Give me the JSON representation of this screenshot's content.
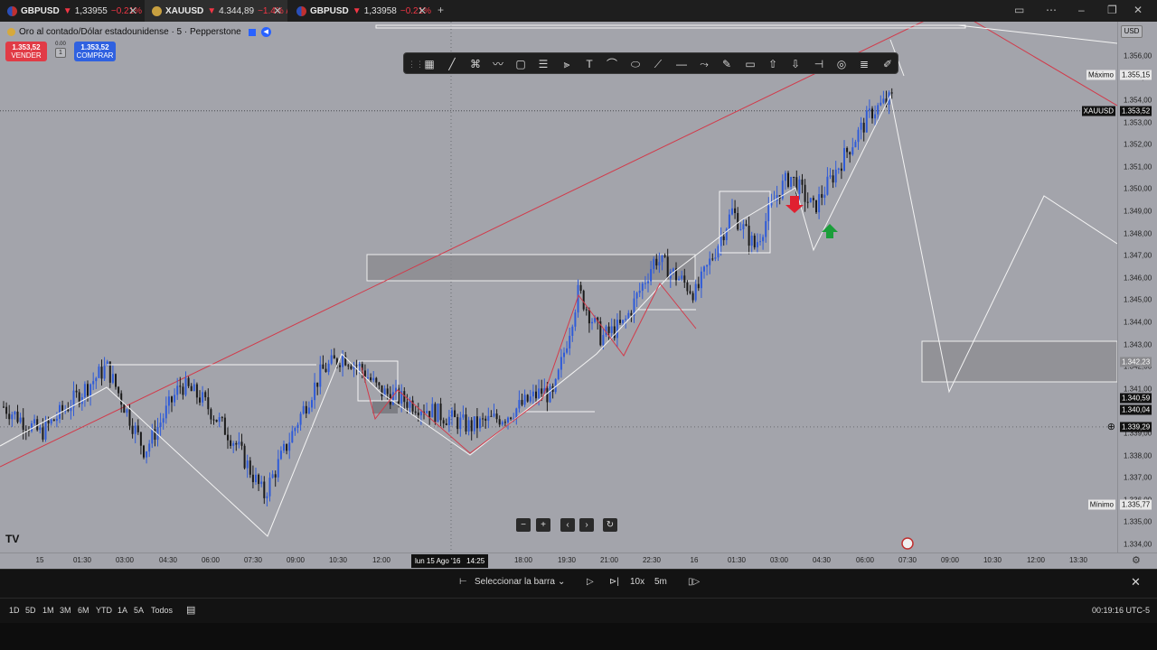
{
  "tabs": [
    {
      "symbol": "GBPUSD",
      "price": "1,33955",
      "change": "−0.21% / ...",
      "active": false
    },
    {
      "symbol": "XAUUSD",
      "price": "4.344,89",
      "change": "−1.4% / ...",
      "active": true
    },
    {
      "symbol": "GBPUSD",
      "price": "1,33958",
      "change": "−0.21% / ...",
      "active": false
    }
  ],
  "legend": {
    "title": "Oro al contado/Dólar estadounidense · 5 · Pepperstone"
  },
  "trade": {
    "sell_price": "1.353,52",
    "sell_label": "VENDER",
    "buy_price": "1.353,52",
    "buy_label": "COMPRAR",
    "spread": "0.00",
    "qty": "1"
  },
  "price_axis": {
    "currency": "USD",
    "ticks": [
      "1.356,00",
      "1.355,00",
      "1.354,00",
      "1.353,00",
      "1.352,00",
      "1.351,00",
      "1.350,00",
      "1.349,00",
      "1.348,00",
      "1.347,00",
      "1.346,00",
      "1.345,00",
      "1.344,00",
      "1.343,00",
      "1.342,00",
      "1.341,00",
      "1.340,00",
      "1.339,00",
      "1.338,00",
      "1.337,00",
      "1.336,00",
      "1.335,00",
      "1.334,00"
    ],
    "labels": {
      "maximo_text": "Máximo",
      "maximo_value": "1.355,15",
      "symbol_text": "XAUUSD",
      "symbol_value": "1.353,52",
      "zone_value": "1.342,23",
      "level1": "1.340,59",
      "level2": "1.340,04",
      "crosshair": "1.339,29",
      "minimo_text": "Mínimo",
      "minimo_value": "1.335,77"
    }
  },
  "time_axis": {
    "ticks": [
      "15",
      "01:30",
      "03:00",
      "04:30",
      "06:00",
      "07:30",
      "09:00",
      "10:30",
      "12:00",
      "18:00",
      "19:30",
      "21:00",
      "22:30",
      "16",
      "01:30",
      "03:00",
      "04:30",
      "06:00",
      "07:30",
      "09:00",
      "10:30",
      "12:00",
      "13:30"
    ],
    "cursor_label": "lun 15 Ago '16   14:25"
  },
  "replay": {
    "select_bar": "Seleccionar la barra",
    "speed": "10x",
    "interval": "5m"
  },
  "ranges": [
    "1D",
    "5D",
    "1M",
    "3M",
    "6M",
    "YTD",
    "1A",
    "5A",
    "Todos"
  ],
  "clock": "00:19:16 UTC-5",
  "colors": {
    "chart_bg": "#a3a4ab",
    "bull": "#2f5bd8",
    "bear": "#1a1a1a",
    "trendline": "#d23a4a",
    "zone": "#8a8a8e",
    "sell": "#e13b46",
    "buy": "#2f61e0"
  },
  "icons": [
    "grid-icon",
    "trendline-icon",
    "fib-icon",
    "pattern-icon",
    "rect-icon",
    "channel-icon",
    "pitchfork-icon",
    "text-icon",
    "curve-icon",
    "ellipse-icon",
    "ray-icon",
    "hline-icon",
    "path-icon",
    "brush-icon",
    "callout-icon",
    "arrow-up-icon",
    "arrow-down-icon",
    "ruler-icon",
    "circle-icon",
    "bars-icon",
    "pen-icon"
  ]
}
